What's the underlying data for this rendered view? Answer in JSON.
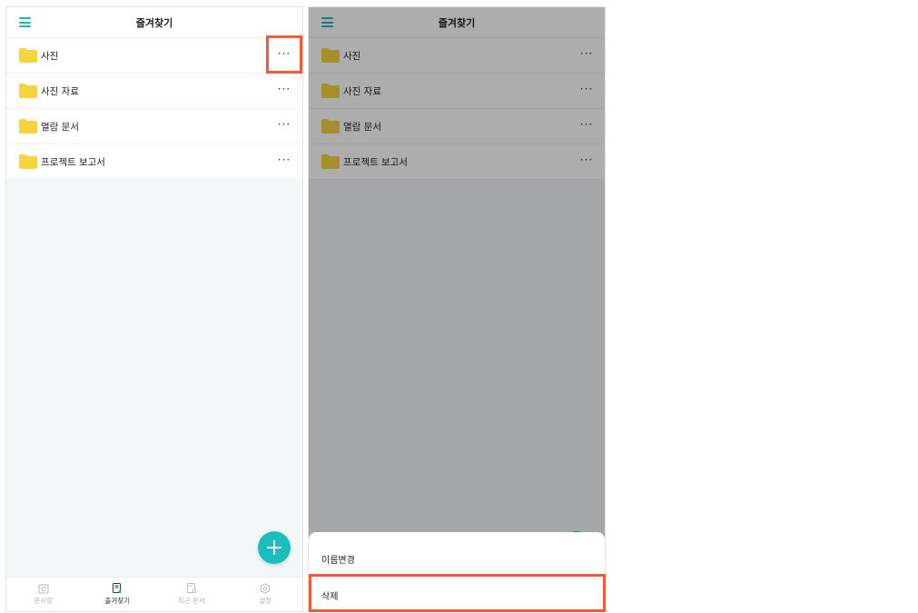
{
  "header": {
    "title": "즐겨찾기"
  },
  "folders": [
    {
      "label": "사진"
    },
    {
      "label": "사진 자료"
    },
    {
      "label": "열람 문서"
    },
    {
      "label": "프로젝트 보고서"
    }
  ],
  "more_glyph": "···",
  "bottom_nav": [
    {
      "label": "문서함",
      "icon": "camera-folder-icon",
      "active": false
    },
    {
      "label": "즐겨찾기",
      "icon": "favorite-doc-icon",
      "active": true
    },
    {
      "label": "최근 문서",
      "icon": "recent-doc-icon",
      "active": false
    },
    {
      "label": "설정",
      "icon": "gear-icon",
      "active": false
    }
  ],
  "action_sheet": {
    "rename_label": "이름변경",
    "delete_label": "삭제"
  },
  "colors": {
    "accent": "#1cbdbd",
    "folder": "#f5d442",
    "highlight": "#f15a36"
  }
}
